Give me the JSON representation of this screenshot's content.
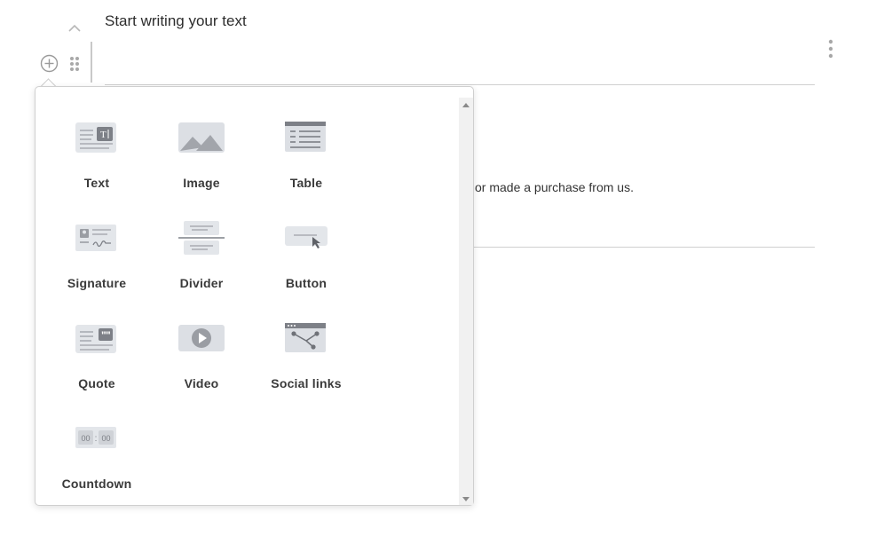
{
  "editor": {
    "placeholder": "Start writing your text",
    "body_text": "or made a purchase from us."
  },
  "icons": {
    "collapse": "chevron-up-icon",
    "add": "plus-circle-icon",
    "drag": "drag-handle-icon",
    "more": "more-vertical-icon"
  },
  "blocks": [
    {
      "label": "Text",
      "icon": "text-block-icon"
    },
    {
      "label": "Image",
      "icon": "image-block-icon"
    },
    {
      "label": "Table",
      "icon": "table-block-icon"
    },
    {
      "label": "Signature",
      "icon": "signature-block-icon"
    },
    {
      "label": "Divider",
      "icon": "divider-block-icon"
    },
    {
      "label": "Button",
      "icon": "button-block-icon"
    },
    {
      "label": "Quote",
      "icon": "quote-block-icon"
    },
    {
      "label": "Video",
      "icon": "video-block-icon"
    },
    {
      "label": "Social links",
      "icon": "social-links-block-icon"
    },
    {
      "label": "Countdown",
      "icon": "countdown-block-icon"
    }
  ],
  "countdown_preview": {
    "left": "00",
    "sep": ":",
    "right": "00"
  },
  "colors": {
    "icon_fill": "#dcdfe4",
    "icon_dark": "#8a8d93",
    "accent": "#7d8087"
  }
}
